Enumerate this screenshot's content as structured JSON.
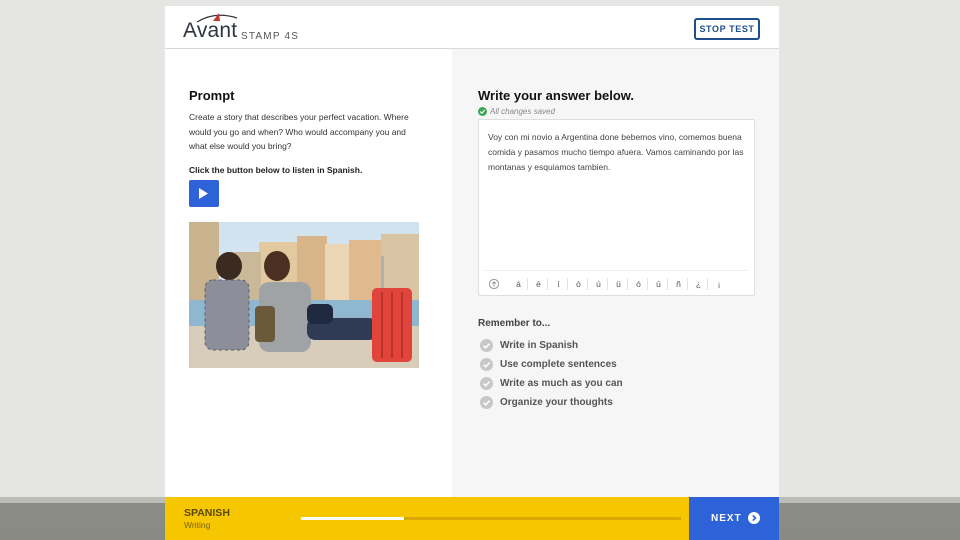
{
  "header": {
    "logo_brand": "Avant",
    "logo_product": "STAMP 4S",
    "stop_test_label": "STOP TEST"
  },
  "prompt": {
    "title": "Prompt",
    "text": "Create a story that describes your perfect vacation. Where would you go and when? Who would accompany you and what else would you bring?",
    "listen_instruction": "Click the button below to listen in Spanish.",
    "play_icon": "play-icon",
    "photo_icon": "photo-couple-with-suitcase"
  },
  "answer": {
    "title": "Write your answer below.",
    "saved_status": "All changes saved",
    "text": "Voy con mi novio a Argentina done bebemos vino, comemos buena comida y pasamos mucho tiempo afuera. Vamos caminando por las montanas y esquiamos tambien.",
    "special_chars": [
      "á",
      "é",
      "í",
      "ó",
      "ú",
      "ü",
      "ó",
      "ú",
      "ñ",
      "¿",
      "¡"
    ]
  },
  "remember": {
    "title": "Remember to...",
    "items": [
      "Write in Spanish",
      "Use complete sentences",
      "Write as much as you can",
      "Organize your thoughts"
    ]
  },
  "footer": {
    "language": "SPANISH",
    "skill": "Writing",
    "progress": 0.27,
    "next_label": "NEXT"
  },
  "colors": {
    "accent_blue": "#2d62d8",
    "footer_yellow": "#f6c600",
    "saved_green": "#3aa757"
  }
}
